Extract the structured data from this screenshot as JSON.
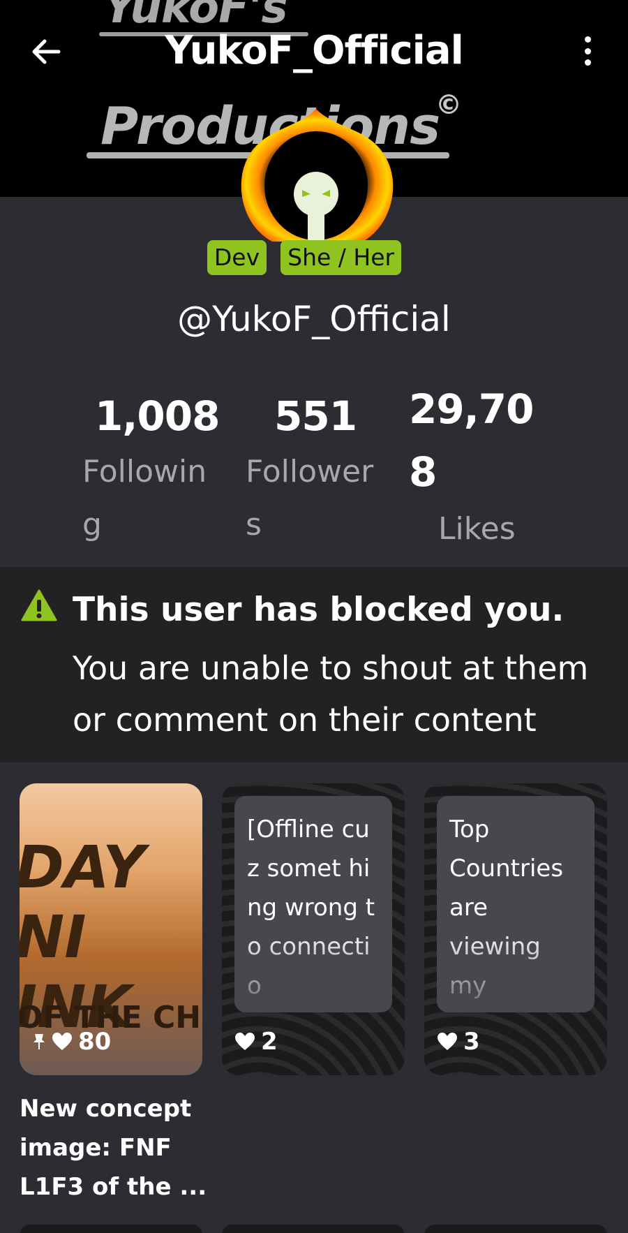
{
  "header": {
    "title": "YukoF_Official",
    "banner_line1": "YukoF's",
    "banner_line2": "Productions",
    "banner_symbol": "©"
  },
  "badges": [
    {
      "label": "Dev",
      "color": "#8fc31f"
    },
    {
      "label": "She / Her",
      "color": "#8fc31f"
    }
  ],
  "profile": {
    "handle": "@YukoF_Official"
  },
  "stats": {
    "following": {
      "value": "1,008",
      "label_line1": "Followin",
      "label_line2": "g"
    },
    "followers": {
      "value": "551",
      "label_line1": "Follower",
      "label_line2": "s"
    },
    "likes": {
      "value_line1": "29,70",
      "value_line2": "8",
      "label": "Likes"
    }
  },
  "notice": {
    "title": "This user has blocked you.",
    "body": "You are unable to shout at them or comment on their content",
    "icon": "warning-icon",
    "icon_color": "#8fc31f"
  },
  "posts": [
    {
      "type": "image",
      "image_text_top": "DAY NI INK",
      "image_text_bottom": "OF THE CH",
      "pinned": true,
      "likes": "80",
      "caption": "New concept image: FNF L1F3 of the ..."
    },
    {
      "type": "text",
      "text": "[Offline cuz somet hing wrong to connectio",
      "likes": "2"
    },
    {
      "type": "text",
      "text": "Top Countries are viewing my",
      "likes": "3"
    }
  ],
  "colors": {
    "background": "#2d2c33",
    "banner": "#000000",
    "notice_bg": "#222225",
    "accent": "#8fc31f"
  }
}
